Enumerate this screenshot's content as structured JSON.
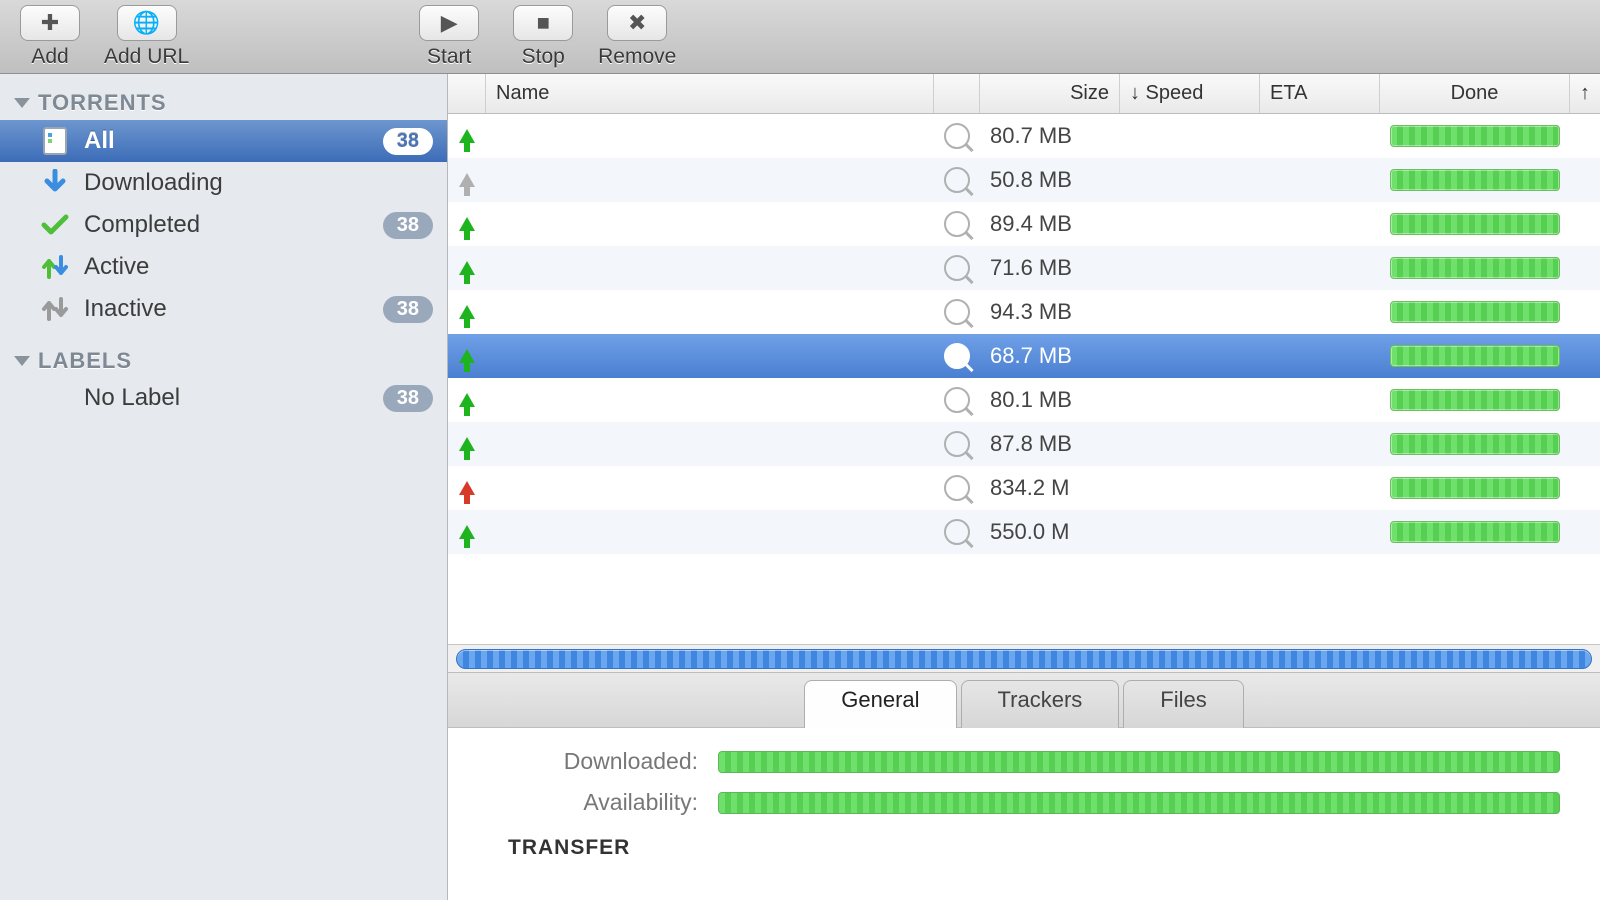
{
  "toolbar": {
    "add": "Add",
    "add_url": "Add URL",
    "start": "Start",
    "stop": "Stop",
    "remove": "Remove"
  },
  "sidebar": {
    "torrents_header": "TORRENTS",
    "labels_header": "LABELS",
    "items": [
      {
        "label": "All",
        "count": "38",
        "selected": true,
        "icon": "file-icon"
      },
      {
        "label": "Downloading",
        "count": "",
        "selected": false,
        "icon": "download-arrow-icon"
      },
      {
        "label": "Completed",
        "count": "38",
        "selected": false,
        "icon": "check-icon"
      },
      {
        "label": "Active",
        "count": "",
        "selected": false,
        "icon": "active-arrows-icon"
      },
      {
        "label": "Inactive",
        "count": "38",
        "selected": false,
        "icon": "inactive-arrows-icon"
      }
    ],
    "label_items": [
      {
        "label": "No Label",
        "count": "38"
      }
    ]
  },
  "columns": {
    "name": "Name",
    "size": "Size",
    "speed": "↓ Speed",
    "eta": "ETA",
    "done": "Done"
  },
  "rows": [
    {
      "arrow": "green",
      "size": "80.7 MB",
      "selected": false
    },
    {
      "arrow": "gray",
      "size": "50.8 MB",
      "selected": false
    },
    {
      "arrow": "green",
      "size": "89.4 MB",
      "selected": false
    },
    {
      "arrow": "green",
      "size": "71.6 MB",
      "selected": false
    },
    {
      "arrow": "green",
      "size": "94.3 MB",
      "selected": false
    },
    {
      "arrow": "green",
      "size": "68.7 MB",
      "selected": true
    },
    {
      "arrow": "green",
      "size": "80.1 MB",
      "selected": false
    },
    {
      "arrow": "green",
      "size": "87.8 MB",
      "selected": false
    },
    {
      "arrow": "red",
      "size": "834.2 M",
      "selected": false
    },
    {
      "arrow": "green",
      "size": "550.0 M",
      "selected": false
    }
  ],
  "detail_tabs": [
    {
      "label": "General",
      "active": true
    },
    {
      "label": "Trackers",
      "active": false
    },
    {
      "label": "Files",
      "active": false
    }
  ],
  "detail": {
    "downloaded": "Downloaded:",
    "availability": "Availability:",
    "transfer_heading": "TRANSFER"
  }
}
